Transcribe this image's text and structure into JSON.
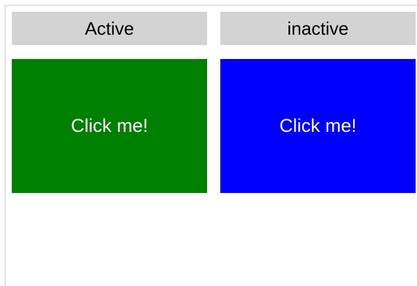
{
  "tabs": [
    {
      "label": "Active"
    },
    {
      "label": "inactive"
    }
  ],
  "buttons": [
    {
      "label": "Click me!",
      "color": "#008000"
    },
    {
      "label": "Click me!",
      "color": "#0000ff"
    }
  ],
  "colors": {
    "header_bg": "#d3d3d3",
    "text_dark": "#000000",
    "text_light": "#ffffff"
  }
}
